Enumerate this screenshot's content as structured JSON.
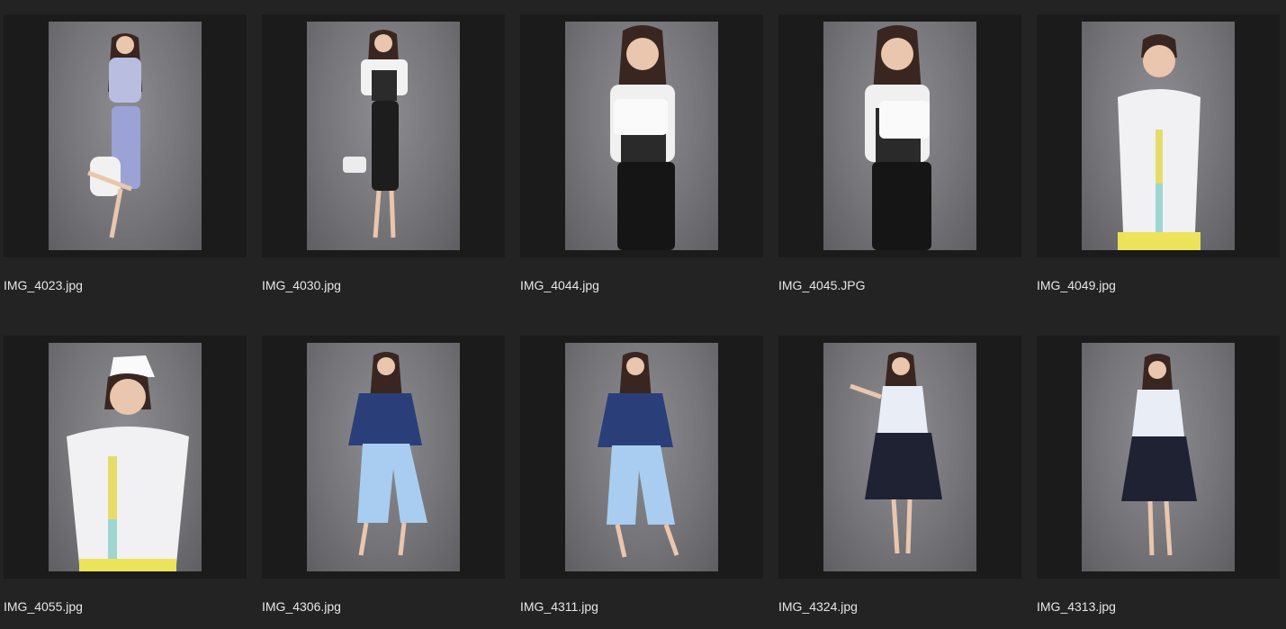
{
  "files": [
    {
      "name": "IMG_4023.jpg",
      "thumbnail": "woman in blue patterned crop top and skirt holding clutch"
    },
    {
      "name": "IMG_4030.jpg",
      "thumbnail": "woman in striped tee and black mesh skirt holding clutch"
    },
    {
      "name": "IMG_4044.jpg",
      "thumbnail": "woman in striped tee holding white bag"
    },
    {
      "name": "IMG_4045.JPG",
      "thumbnail": "woman in striped tee holding white bag, hand near face"
    },
    {
      "name": "IMG_4049.jpg",
      "thumbnail": "woman in white shirt with colored stripe"
    },
    {
      "name": "IMG_4055.jpg",
      "thumbnail": "woman in white nurse-style shirt and cap"
    },
    {
      "name": "IMG_4306.jpg",
      "thumbnail": "woman in navy lace top and light blue wide trousers"
    },
    {
      "name": "IMG_4311.jpg",
      "thumbnail": "woman in navy lace top and light blue culottes"
    },
    {
      "name": "IMG_4324.jpg",
      "thumbnail": "woman in striped halter top and navy skirt waving"
    },
    {
      "name": "IMG_4313.jpg",
      "thumbnail": "woman in striped halter top and navy skirt"
    }
  ],
  "colors": {
    "background": "#232323",
    "tile_frame": "#1b1b1b",
    "caption_text": "#e6e6e6",
    "backdrop": "#7b7b7f"
  }
}
